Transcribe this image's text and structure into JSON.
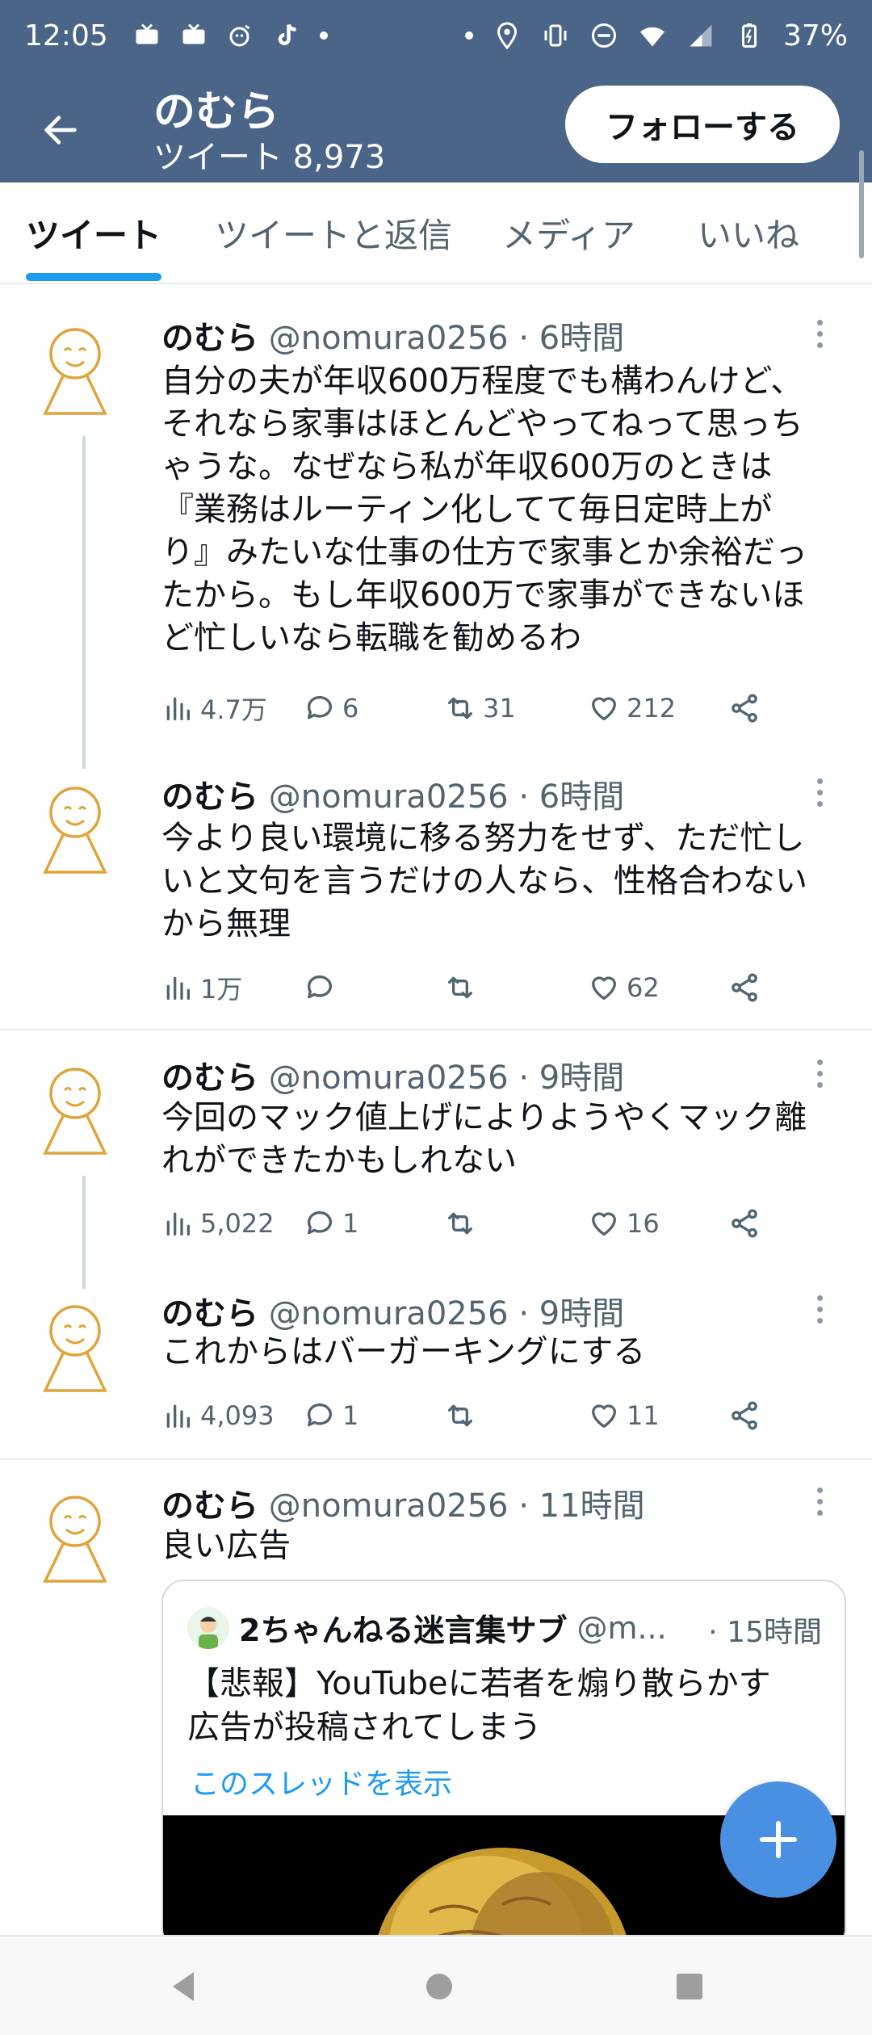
{
  "status_bar": {
    "time": "12:05",
    "battery": "37%",
    "icons": [
      "tv-icon",
      "tv-icon",
      "assistant-icon",
      "tiktok-icon",
      "dot",
      "dot",
      "location-icon",
      "vibrate-icon",
      "dnd-icon",
      "wifi-icon",
      "signal-icon",
      "battery-icon"
    ]
  },
  "header": {
    "name": "のむら",
    "tweet_count": "ツイート 8,973",
    "follow_label": "フォローする"
  },
  "tabs": [
    {
      "label": "ツイート",
      "active": true
    },
    {
      "label": "ツイートと返信",
      "active": false
    },
    {
      "label": "メディア",
      "active": false
    },
    {
      "label": "いいね",
      "active": false
    }
  ],
  "tweets": [
    {
      "name": "のむら",
      "handle": "@nomura0256",
      "time": "· 6時間",
      "lines": [
        "自分の夫が年収600万程度でも構わんけど、",
        "それなら家事はほとんどやってねって思っち",
        "ゃうな。なぜなら私が年収600万のときは",
        "『業務はルーティン化してて毎日定時上が",
        "り』みたいな仕事の仕方で家事とか余裕だっ",
        "たから。もし年収600万で家事ができないほ",
        "ど忙しいなら転職を勧めるわ"
      ],
      "views": "4.7万",
      "replies": "6",
      "retweets": "31",
      "likes": "212"
    },
    {
      "name": "のむら",
      "handle": "@nomura0256",
      "time": "· 6時間",
      "lines": [
        "今より良い環境に移る努力をせず、ただ忙し",
        "いと文句を言うだけの人なら、性格合わない",
        "から無理"
      ],
      "views": "1万",
      "replies": "",
      "retweets": "",
      "likes": "62"
    },
    {
      "name": "のむら",
      "handle": "@nomura0256",
      "time": "· 9時間",
      "lines": [
        "今回のマック値上げによりようやくマック離",
        "れができたかもしれない"
      ],
      "views": "5,022",
      "replies": "1",
      "retweets": "",
      "likes": "16"
    },
    {
      "name": "のむら",
      "handle": "@nomura0256",
      "time": "· 9時間",
      "lines": [
        "これからはバーガーキングにする"
      ],
      "views": "4,093",
      "replies": "1",
      "retweets": "",
      "likes": "11"
    },
    {
      "name": "のむら",
      "handle": "@nomura0256",
      "time": "· 11時間",
      "lines": [
        "良い広告"
      ]
    }
  ],
  "quote": {
    "name": "2ちゃんねる迷言集サブ",
    "handle": "@m...",
    "time": "· 15時間",
    "lines": [
      "【悲報】YouTubeに若者を煽り散らかす",
      "広告が投稿されてしまう"
    ],
    "link": "このスレッドを表示"
  },
  "colors": {
    "header_bg": "#4a6587",
    "accent": "#1d9bf0",
    "fab": "#4a90e2",
    "avatar_stroke": "#e0a43a"
  }
}
